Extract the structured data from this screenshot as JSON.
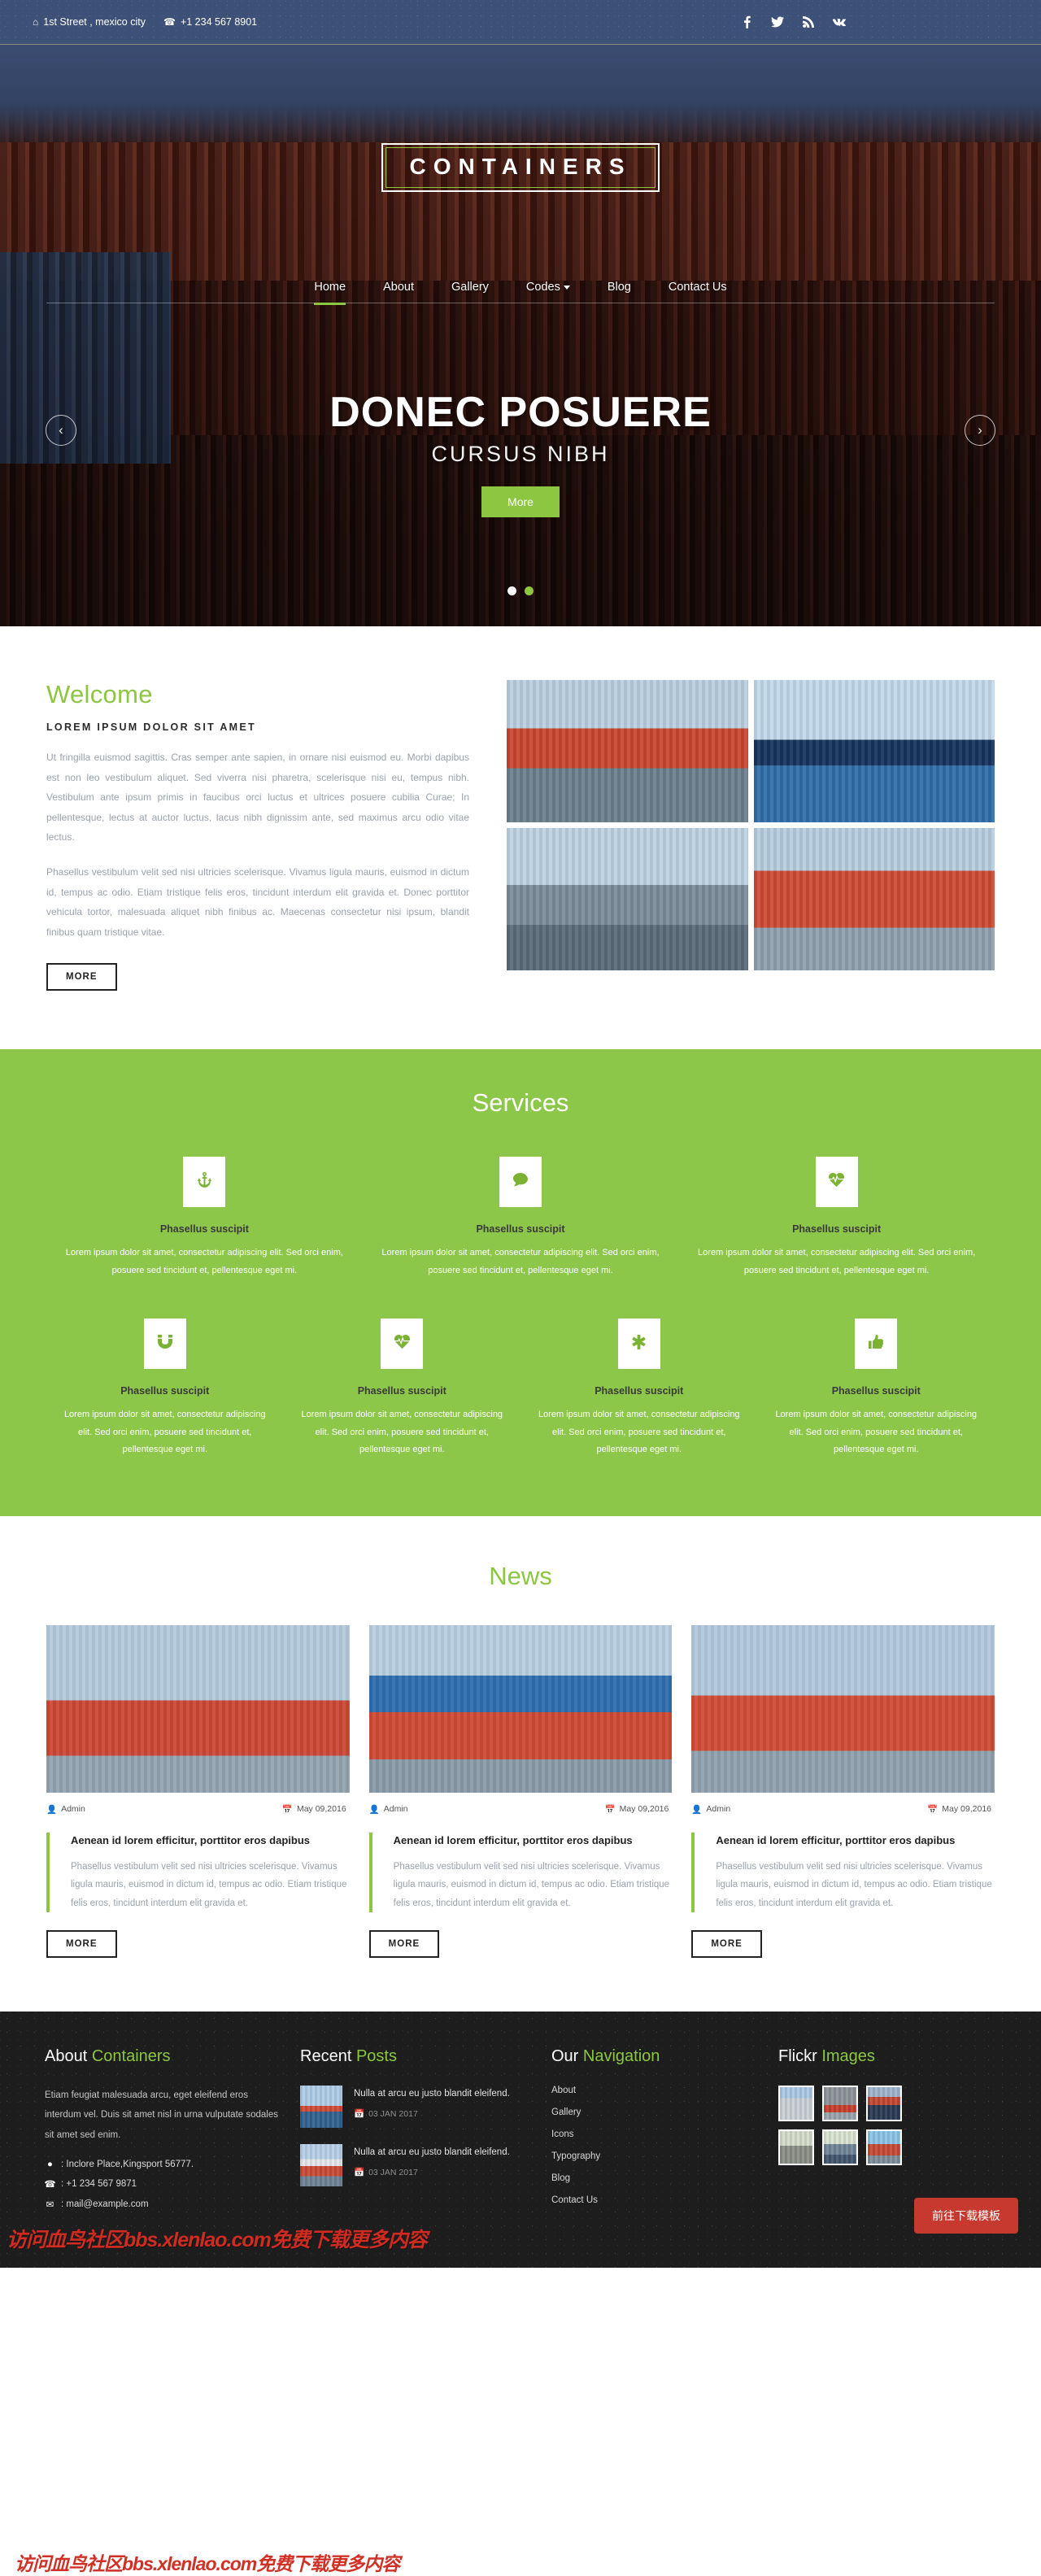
{
  "topbar": {
    "address": "1st Street , mexico city",
    "phone": "+1 234 567 8901",
    "social": [
      "facebook-icon",
      "twitter-icon",
      "rss-icon",
      "vk-icon"
    ]
  },
  "header": {
    "logo": "CONTAINERS",
    "nav": [
      {
        "label": "Home",
        "active": true,
        "caret": false
      },
      {
        "label": "About",
        "active": false,
        "caret": false
      },
      {
        "label": "Gallery",
        "active": false,
        "caret": false
      },
      {
        "label": "Codes",
        "active": false,
        "caret": true
      },
      {
        "label": "Blog",
        "active": false,
        "caret": false
      },
      {
        "label": "Contact Us",
        "active": false,
        "caret": false
      }
    ]
  },
  "slider": {
    "title": "DONEC POSUERE",
    "subtitle": "CURSUS NIBH",
    "button": "More",
    "prev_icon": "chevron-left-icon",
    "next_icon": "chevron-right-icon",
    "dots": 2,
    "active_dot": 1
  },
  "welcome": {
    "title": "Welcome",
    "subtitle": "LOREM IPSUM DOLOR SIT AMET",
    "p1": "Ut fringilla euismod sagittis. Cras semper ante sapien, in ornare nisi euismod eu. Morbi dapibus est non leo vestibulum aliquet. Sed viverra nisi pharetra, scelerisque nisi eu, tempus nibh. Vestibulum ante ipsum primis in faucibus orci luctus et ultrices posuere cubilia Curae; In pellentesque, lectus at auctor luctus, lacus nibh dignissim ante, sed maximus arcu odio vitae lectus.",
    "p2": "Phasellus vestibulum velit sed nisi ultricies scelerisque. Vivamus ligula mauris, euismod in dictum id, tempus ac odio. Etiam tristique felis eros, tincidunt interdum elit gravida et. Donec porttitor vehicula tortor, malesuada aliquet nibh finibus ac. Maecenas consectetur nisi ipsum, blandit finibus quam tristique vitae.",
    "button": "MORE",
    "images": [
      "port-containers-photo",
      "container-ship-photo",
      "dock-crane-photo",
      "cranes-yard-photo"
    ]
  },
  "services": {
    "title": "Services",
    "row1": [
      {
        "icon": "anchor-icon",
        "heading": "Phasellus suscipit",
        "text": "Lorem ipsum dolor sit amet, consectetur adipiscing elit. Sed orci enim, posuere sed tincidunt et, pellentesque eget mi."
      },
      {
        "icon": "comment-icon",
        "heading": "Phasellus suscipit",
        "text": "Lorem ipsum dolor sit amet, consectetur adipiscing elit. Sed orci enim, posuere sed tincidunt et, pellentesque eget mi."
      },
      {
        "icon": "heartbeat-icon",
        "heading": "Phasellus suscipit",
        "text": "Lorem ipsum dolor sit amet, consectetur adipiscing elit. Sed orci enim, posuere sed tincidunt et, pellentesque eget mi."
      }
    ],
    "row2": [
      {
        "icon": "magnet-icon",
        "heading": "Phasellus suscipit",
        "text": "Lorem ipsum dolor sit amet, consectetur adipiscing elit. Sed orci enim, posuere sed tincidunt et, pellentesque eget mi."
      },
      {
        "icon": "heartbeat-icon",
        "heading": "Phasellus suscipit",
        "text": "Lorem ipsum dolor sit amet, consectetur adipiscing elit. Sed orci enim, posuere sed tincidunt et, pellentesque eget mi."
      },
      {
        "icon": "asterisk-icon",
        "heading": "Phasellus suscipit",
        "text": "Lorem ipsum dolor sit amet, consectetur adipiscing elit. Sed orci enim, posuere sed tincidunt et, pellentesque eget mi."
      },
      {
        "icon": "thumbs-up-icon",
        "heading": "Phasellus suscipit",
        "text": "Lorem ipsum dolor sit amet, consectetur adipiscing elit. Sed orci enim, posuere sed tincidunt et, pellentesque eget mi."
      }
    ]
  },
  "news": {
    "title": "News",
    "cards": [
      {
        "author": "Admin",
        "date": "May 09,2016",
        "heading": "Aenean id lorem efficitur, porttitor eros dapibus",
        "text": "Phasellus vestibulum velit sed nisi ultricies scelerisque. Vivamus ligula mauris, euismod in dictum id, tempus ac odio. Etiam tristique felis eros, tincidunt interdum elit gravida et.",
        "button": "MORE"
      },
      {
        "author": "Admin",
        "date": "May 09,2016",
        "heading": "Aenean id lorem efficitur, porttitor eros dapibus",
        "text": "Phasellus vestibulum velit sed nisi ultricies scelerisque. Vivamus ligula mauris, euismod in dictum id, tempus ac odio. Etiam tristique felis eros, tincidunt interdum elit gravida et.",
        "button": "MORE"
      },
      {
        "author": "Admin",
        "date": "May 09,2016",
        "heading": "Aenean id lorem efficitur, porttitor eros dapibus",
        "text": "Phasellus vestibulum velit sed nisi ultricies scelerisque. Vivamus ligula mauris, euismod in dictum id, tempus ac odio. Etiam tristique felis eros, tincidunt interdum elit gravida et.",
        "button": "MORE"
      }
    ]
  },
  "footer": {
    "about": {
      "title_1": "About ",
      "title_2": "Containers",
      "text": "Etiam feugiat malesuada arcu, eget eleifend eros interdum vel. Duis sit amet nisl in urna vulputate sodales sit amet sed enim.",
      "address": ": Inclore Place,Kingsport 56777.",
      "phone": ": +1 234 567 9871",
      "email": ": mail@example.com"
    },
    "posts": {
      "title_1": "Recent ",
      "title_2": "Posts",
      "items": [
        {
          "title": "Nulla at arcu eu justo blandit eleifend.",
          "date": "03 JAN 2017"
        },
        {
          "title": "Nulla at arcu eu justo blandit eleifend.",
          "date": "03 JAN 2017"
        }
      ]
    },
    "navigation": {
      "title_1": "Our ",
      "title_2": "Navigation",
      "items": [
        "About",
        "Gallery",
        "Icons",
        "Typography",
        "Blog",
        "Contact Us"
      ]
    },
    "flickr": {
      "title_1": "Flickr ",
      "title_2": "Images",
      "thumbs": [
        "port-aerial-photo",
        "red-ship-photo",
        "harbour-ship-photo",
        "wreck-ship-photo",
        "crane-row-photo",
        "container-crane-photo"
      ]
    },
    "download_button": "前往下载模板",
    "watermark": "访问血鸟社区bbs.xlenlao.com免费下载更多内容"
  },
  "colors": {
    "accent_green": "#8dc641",
    "services_bg": "#8dc74a",
    "topbar_bg": "#3d5078",
    "footer_bg": "#1d1d1d",
    "download_red": "#c7392f"
  }
}
